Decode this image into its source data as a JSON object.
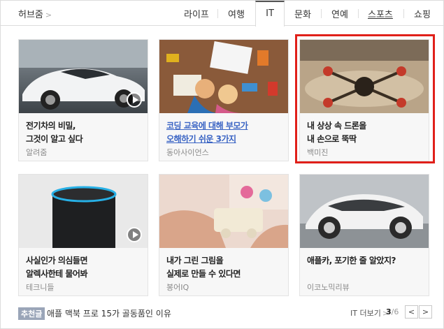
{
  "header": {
    "hub_label": "허브줌",
    "hub_arrow": ">",
    "tabs": [
      "라이프",
      "여행",
      "IT",
      "문화",
      "연예",
      "스포츠",
      "쇼핑"
    ],
    "active_tab": "IT"
  },
  "cards": [
    {
      "title_line1": "전기차의 비밀,",
      "title_line2": "그것이 알고 싶다",
      "source": "알려줌",
      "image": "white-tesla-car",
      "has_video": true
    },
    {
      "title_line1": "코딩 교육에 대해 부모가",
      "title_line2": "오해하기 쉬운 3가지",
      "source": "동아사이언스",
      "image": "kids-with-laptop",
      "has_video": false
    },
    {
      "title_line1": "내 상상 속 드론을",
      "title_line2": "내 손으로 뚝딱",
      "source": "백미진",
      "image": "drone-on-table",
      "has_video": false
    },
    {
      "title_line1": "사실인가 의심들면",
      "title_line2": "알렉사한테 물어봐",
      "source": "테크니들",
      "image": "amazon-echo-speaker",
      "has_video": true
    },
    {
      "title_line1": "내가 그린 그림을",
      "title_line2": "실제로 만들 수 있다면",
      "source": "봉어IQ",
      "image": "3d-printed-toy",
      "has_video": false
    },
    {
      "title_line1": "애플카, 포기한 줄 알았지?",
      "title_line2": "",
      "source": "이코노믹리뷰",
      "image": "concept-car",
      "has_video": false
    }
  ],
  "footer": {
    "badge": "추천글",
    "recommended": "애플 맥북 프로 15가 골동품인 이유",
    "more": "IT 더보기",
    "more_arrow": ">",
    "page_current": "3",
    "page_total": "6",
    "prev": "<",
    "next": ">"
  },
  "colors": {
    "highlight": "#e0201a",
    "link": "#3a64c4",
    "badge": "#9aa5b8"
  }
}
